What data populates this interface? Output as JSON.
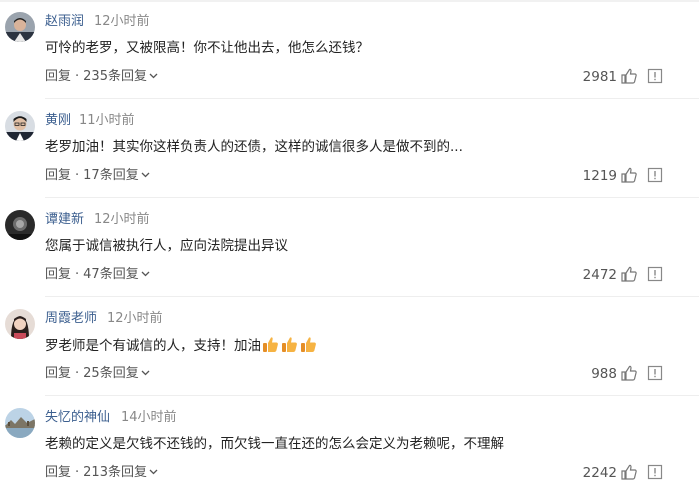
{
  "comments": [
    {
      "username": "赵雨润",
      "time": "12小时前",
      "text": "可怜的老罗，又被限高！你不让他出去，他怎么还钱？",
      "reply_label": "回复",
      "separator": "·",
      "replies_label": "235条回复",
      "likes": "2981",
      "avatar_icon": "user-avatar-man-suit"
    },
    {
      "username": "黄刚",
      "time": "11小时前",
      "text": "老罗加油！其实你这样负责人的还债，这样的诚信很多人是做不到的...",
      "reply_label": "回复",
      "separator": "·",
      "replies_label": "17条回复",
      "likes": "1219",
      "avatar_icon": "user-avatar-man-glasses"
    },
    {
      "username": "谭建新",
      "time": "12小时前",
      "text": "您属于诚信被执行人，应向法院提出异议",
      "reply_label": "回复",
      "separator": "·",
      "replies_label": "47条回复",
      "likes": "2472",
      "avatar_icon": "user-avatar-dark"
    },
    {
      "username": "周霞老师",
      "time": "12小时前",
      "text": "罗老师是个有诚信的人，支持！加油",
      "emoji": [
        "thumbs-up-emoji",
        "thumbs-up-emoji",
        "thumbs-up-emoji"
      ],
      "reply_label": "回复",
      "separator": "·",
      "replies_label": "25条回复",
      "likes": "988",
      "avatar_icon": "user-avatar-woman"
    },
    {
      "username": "失忆的神仙",
      "time": "14小时前",
      "text": "老赖的定义是欠钱不还钱的，而欠钱一直在还的怎么会定义为老赖呢，不理解",
      "reply_label": "回复",
      "separator": "·",
      "replies_label": "213条回复",
      "likes": "2242",
      "avatar_icon": "user-avatar-landscape"
    }
  ],
  "colors": {
    "username": "#3c5f8f",
    "meta": "#888888",
    "text": "#222222",
    "action": "#555555",
    "emoji": "#f0a830"
  }
}
